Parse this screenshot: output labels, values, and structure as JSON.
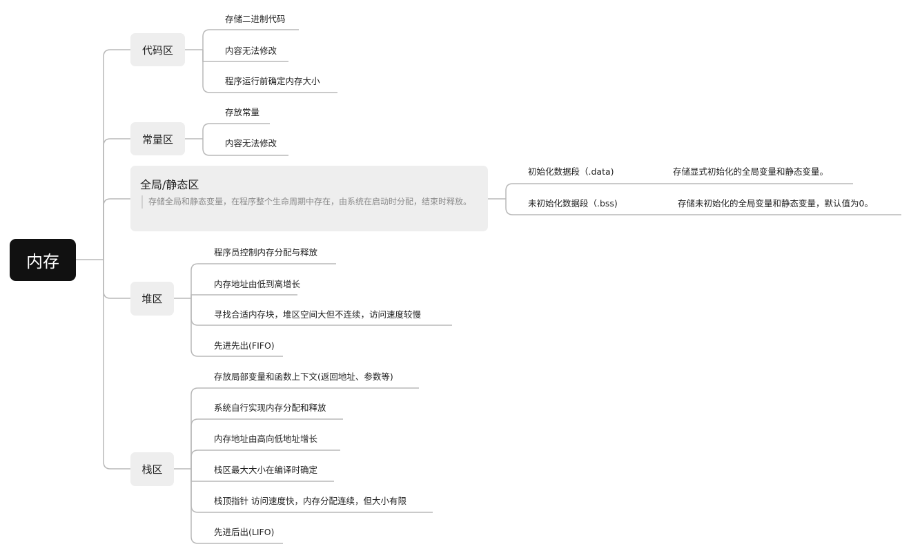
{
  "root": {
    "label": "内存"
  },
  "branches": {
    "code": {
      "label": "代码区",
      "items": [
        "存储二进制代码",
        "内容无法修改",
        "程序运行前确定内存大小"
      ]
    },
    "const": {
      "label": "常量区",
      "items": [
        "存放常量",
        "内容无法修改"
      ]
    },
    "global": {
      "label": "全局/静态区",
      "note": "存储全局和静态变量，在程序整个生命周期中存在，由系统在启动时分配，结束时释放。",
      "subs": [
        {
          "label": "初始化数据段（.data)",
          "desc": "存储显式初始化的全局变量和静态变量。"
        },
        {
          "label": "未初始化数据段（.bss)",
          "desc": "存储未初始化的全局变量和静态变量，默认值为0。"
        }
      ]
    },
    "heap": {
      "label": "堆区",
      "items": [
        "程序员控制内存分配与释放",
        "内存地址由低到高增长",
        "寻找合适内存块，堆区空间大但不连续，访问速度较慢",
        "先进先出(FIFO)"
      ]
    },
    "stack": {
      "label": "栈区",
      "items": [
        "存放局部变量和函数上下文(返回地址、参数等)",
        "系统自行实现内存分配和释放",
        "内存地址由高向低地址增长",
        "栈区最大大小在编译时确定",
        "栈顶指针 访问速度快，内存分配连续，但大小有限",
        "先进后出(LIFO)"
      ]
    }
  }
}
